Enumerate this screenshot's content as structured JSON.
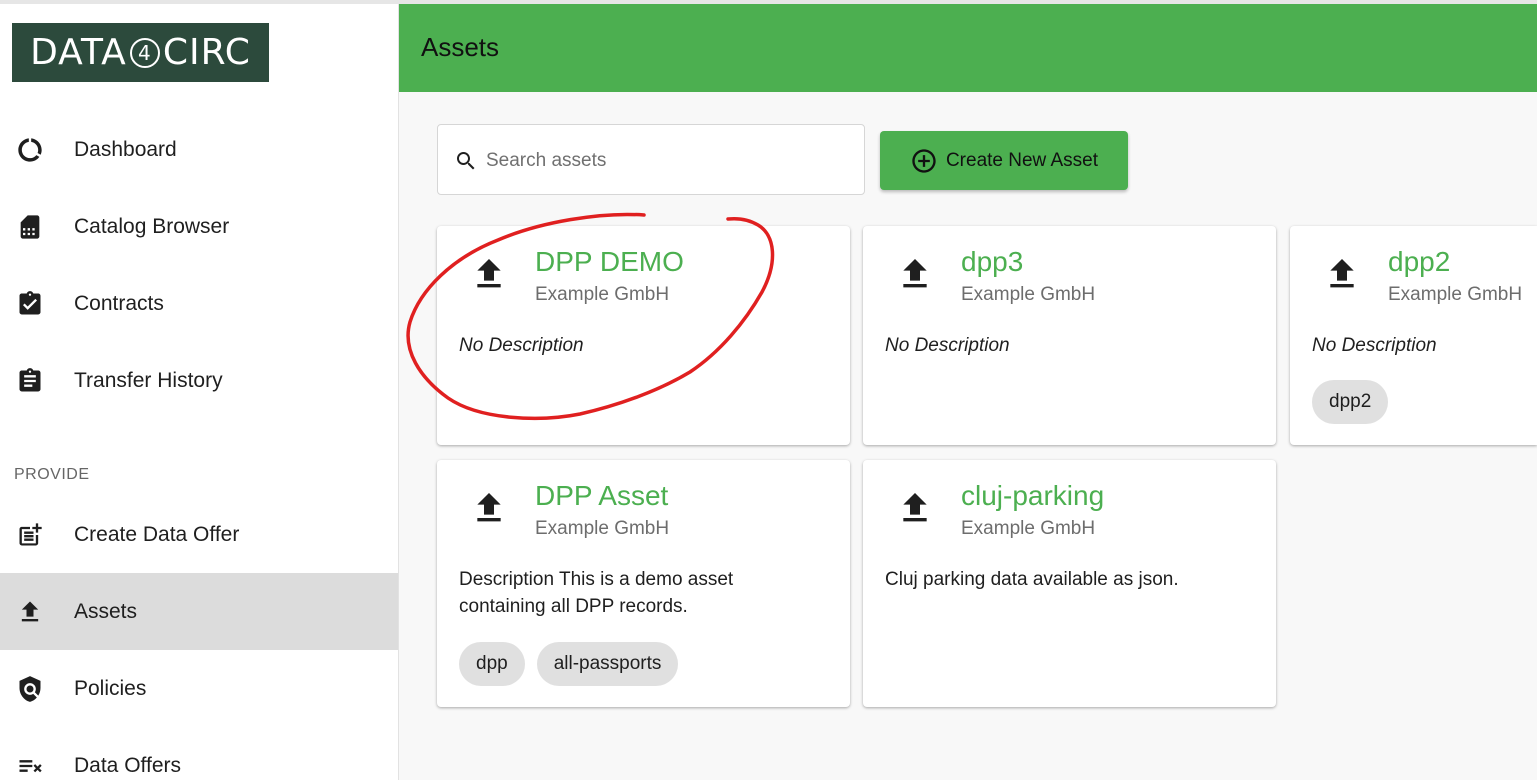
{
  "sidebar": {
    "logo": {
      "left": "DATA",
      "digit": "4",
      "right": "CIRC"
    },
    "items": [
      {
        "label": "Dashboard",
        "icon": "dashboard-icon"
      },
      {
        "label": "Catalog Browser",
        "icon": "catalog-icon"
      },
      {
        "label": "Contracts",
        "icon": "contracts-icon"
      },
      {
        "label": "Transfer History",
        "icon": "transfer-history-icon"
      }
    ],
    "section_provide": "PROVIDE",
    "provide_items": [
      {
        "label": "Create Data Offer",
        "icon": "create-offer-icon"
      },
      {
        "label": "Assets",
        "icon": "upload-icon",
        "active": true
      },
      {
        "label": "Policies",
        "icon": "policy-shield-icon"
      },
      {
        "label": "Data Offers",
        "icon": "data-offers-icon"
      }
    ]
  },
  "header": {
    "title": "Assets"
  },
  "search": {
    "placeholder": "Search assets",
    "value": ""
  },
  "toolbar": {
    "create_label": "Create New Asset"
  },
  "assets": [
    {
      "title": "DPP DEMO",
      "org": "Example GmbH",
      "description": "No Description",
      "tags": []
    },
    {
      "title": "dpp3",
      "org": "Example GmbH",
      "description": "No Description",
      "tags": []
    },
    {
      "title": "dpp2",
      "org": "Example GmbH",
      "description": "No Description",
      "tags": [
        "dpp2"
      ]
    },
    {
      "title": "DPP Asset",
      "org": "Example GmbH",
      "description": "Description This is a demo asset containing all DPP records.",
      "tags": [
        "dpp",
        "all-passports"
      ]
    },
    {
      "title": "cluj-parking",
      "org": "Example GmbH",
      "description": "Cluj parking data available as json.",
      "tags": []
    }
  ],
  "colors": {
    "accent": "#4caf50",
    "logo_bg": "#2c4a3c",
    "annotation": "#e02020"
  }
}
